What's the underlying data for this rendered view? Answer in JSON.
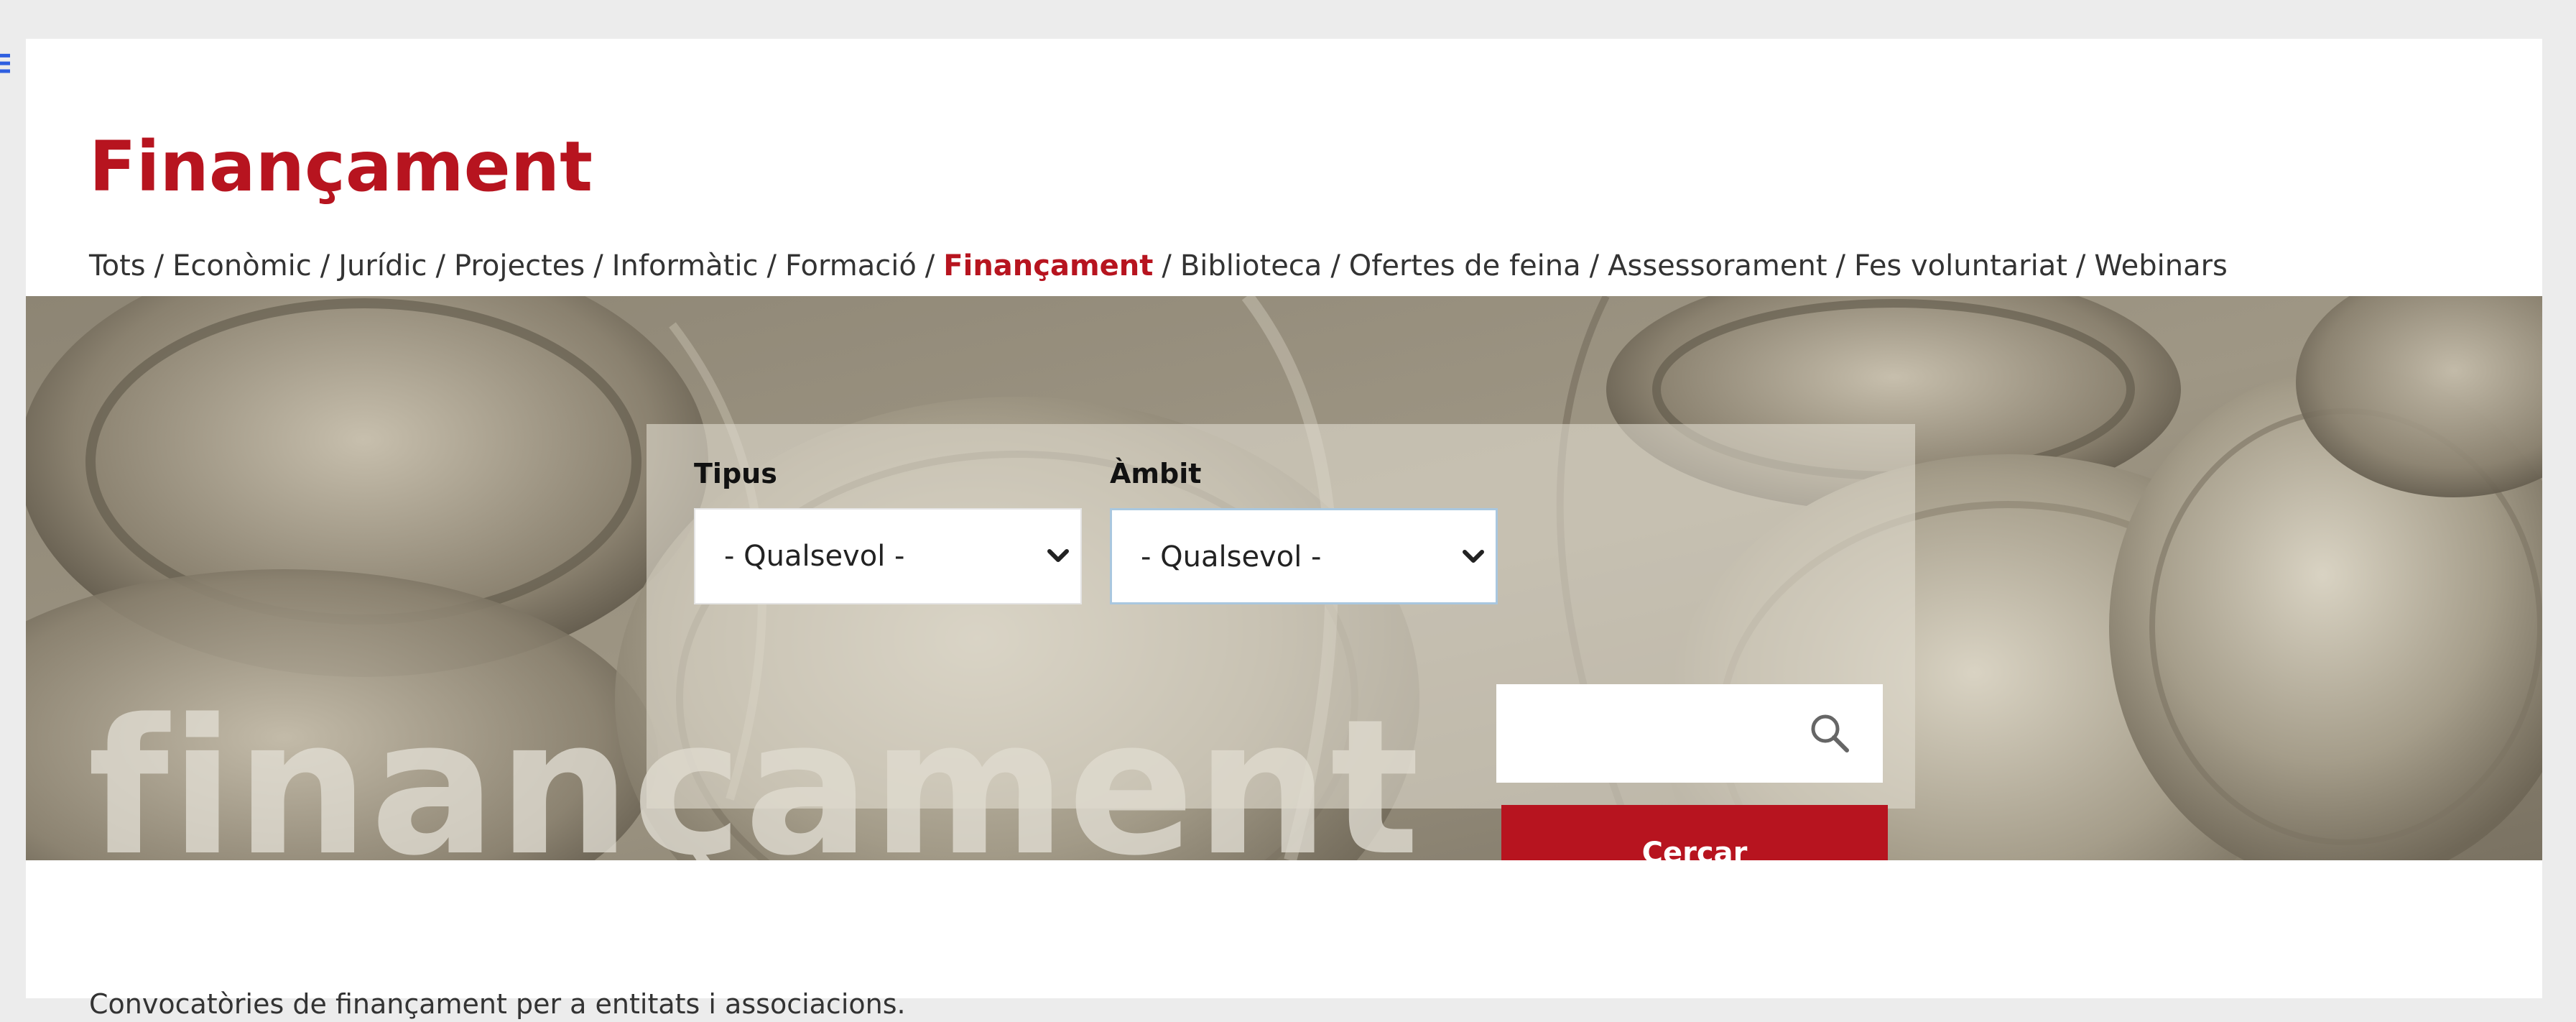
{
  "page": {
    "title": "Finançament",
    "description": "Convocatòries de finançament per a entitats i associacions."
  },
  "breadcrumb": {
    "items": [
      {
        "label": "Tots"
      },
      {
        "label": "Econòmic"
      },
      {
        "label": "Jurídic"
      },
      {
        "label": "Projectes"
      },
      {
        "label": "Informàtic"
      },
      {
        "label": "Formació"
      },
      {
        "label": "Finançament",
        "active": true
      },
      {
        "label": "Biblioteca"
      },
      {
        "label": "Ofertes de feina"
      },
      {
        "label": "Assessorament"
      },
      {
        "label": "Fes voluntariat"
      },
      {
        "label": "Webinars"
      }
    ],
    "separator": "/"
  },
  "hero": {
    "watermark": "finançament"
  },
  "filters": {
    "tipus": {
      "label": "Tipus",
      "value": "- Qualsevol -"
    },
    "ambit": {
      "label": "Àmbit",
      "value": "- Qualsevol -"
    },
    "search": {
      "value": "",
      "placeholder": ""
    },
    "submit_label": "Cercar"
  },
  "icons": {
    "edge": "menu-icon",
    "search": "search-icon",
    "select": "chevron-down-icon"
  },
  "colors": {
    "brand_red": "#b7141f",
    "page_bg": "#ececec",
    "card_bg": "#ffffff"
  }
}
